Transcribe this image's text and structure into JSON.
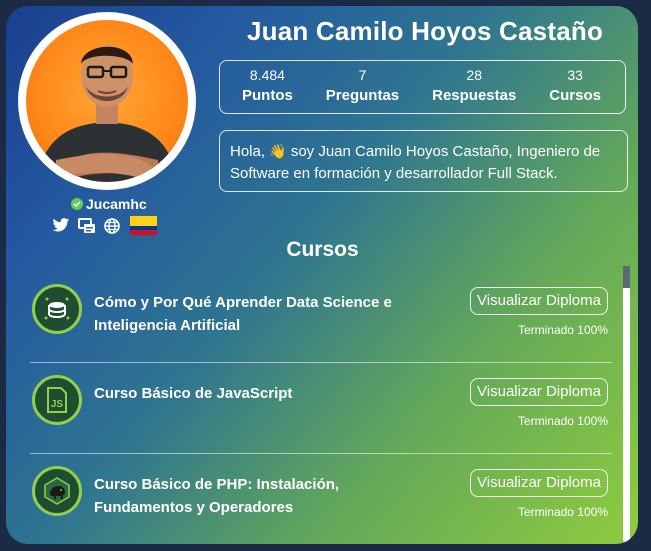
{
  "profile": {
    "name": "Juan Camilo Hoyos Castaño",
    "username": "Jucamhc",
    "bio_greeting": "Hola,",
    "bio_text": "soy Juan Camilo Hoyos Castaño, Ingeniero de Software en formación y desarrollador Full Stack.",
    "country_flag": "colombia-flag",
    "socials": [
      "twitter-icon",
      "portfolio-icon",
      "website-icon"
    ]
  },
  "stats": [
    {
      "value": "8.484",
      "label": "Puntos"
    },
    {
      "value": "7",
      "label": "Preguntas"
    },
    {
      "value": "28",
      "label": "Respuestas"
    },
    {
      "value": "33",
      "label": "Cursos"
    }
  ],
  "courses_section": {
    "title": "Cursos",
    "items": [
      {
        "title": "Cómo y Por Qué Aprender Data Science e Inteligencia Artificial",
        "button": "Visualizar Diploma",
        "status": "Terminado 100%",
        "badge_icon": "data-science-icon"
      },
      {
        "title": "Curso Básico de JavaScript",
        "button": "Visualizar Diploma",
        "status": "Terminado 100%",
        "badge_icon": "javascript-icon"
      },
      {
        "title": "Curso Básico de PHP: Instalación, Fundamentos y Operadores",
        "button": "Visualizar Diploma",
        "status": "Terminado 100%",
        "badge_icon": "php-elephant-icon"
      }
    ]
  },
  "colors": {
    "gradient_start": "#1a3f8e",
    "gradient_end": "#8fcc3d",
    "badge_ring": "#8fd14a",
    "avatar_bg": "#ff8a1a"
  }
}
